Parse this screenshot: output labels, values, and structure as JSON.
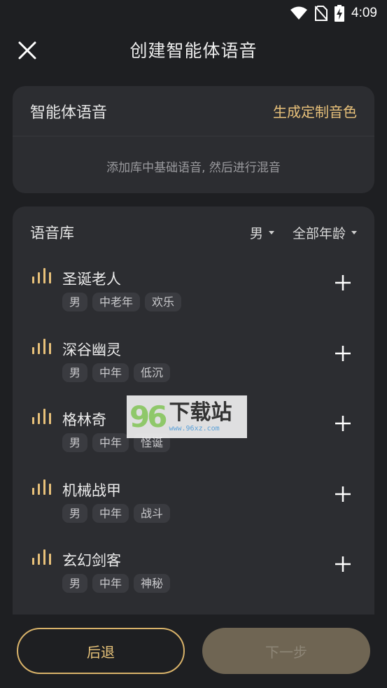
{
  "status_bar": {
    "time": "4:09"
  },
  "header": {
    "title": "创建智能体语音"
  },
  "voice_card": {
    "title": "智能体语音",
    "custom_link": "生成定制音色",
    "hint": "添加库中基础语音, 然后进行混音"
  },
  "library": {
    "title": "语音库",
    "filter_gender": "男",
    "filter_age": "全部年龄",
    "items": [
      {
        "name": "圣诞老人",
        "tags": [
          "男",
          "中老年",
          "欢乐"
        ]
      },
      {
        "name": "深谷幽灵",
        "tags": [
          "男",
          "中年",
          "低沉"
        ]
      },
      {
        "name": "格林奇",
        "tags": [
          "男",
          "中年",
          "怪诞"
        ]
      },
      {
        "name": "机械战甲",
        "tags": [
          "男",
          "中年",
          "战斗"
        ]
      },
      {
        "name": "玄幻剑客",
        "tags": [
          "男",
          "中年",
          "神秘"
        ]
      }
    ]
  },
  "watermark": {
    "logo": "96",
    "text": "下载站",
    "url": "www.96xz.com"
  },
  "footer": {
    "back_label": "后退",
    "next_label": "下一步"
  },
  "colors": {
    "accent": "#e8c17a",
    "card": "#2c2d31",
    "background": "#1e1f22"
  }
}
